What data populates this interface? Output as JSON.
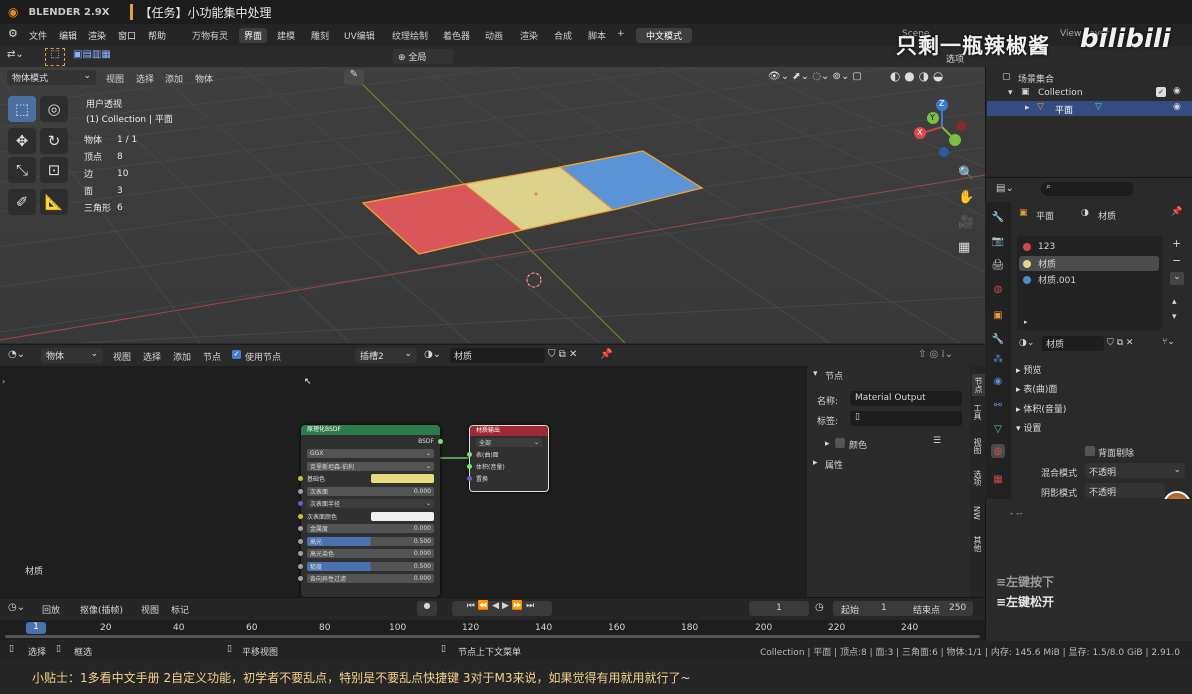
{
  "titlebar": {
    "app_name": "BLENDER 2.9X",
    "window_title": "【任务】小功能集中处理"
  },
  "overlay": {
    "channel_name": "只剩一瓶辣椒酱",
    "brand": "bilibili",
    "side_text": "Scene",
    "view_layer": "View Layer",
    "options": "选项"
  },
  "menu": {
    "items": [
      "文件",
      "编辑",
      "渲染",
      "窗口",
      "帮助"
    ]
  },
  "workspaces": {
    "tabs": [
      "万物有灵",
      "界面",
      "建模",
      "雕刻",
      "UV编辑",
      "纹理绘制",
      "着色器",
      "动画",
      "渲染",
      "合成",
      "脚本"
    ],
    "active": "界面",
    "add": "+",
    "mode_chip": "中文模式"
  },
  "viewport": {
    "mode": "物体模式",
    "menus": [
      "视图",
      "选择",
      "添加",
      "物体"
    ],
    "transform_orient": "全局",
    "view_name": "用户透视",
    "collection_info": "(1) Collection | 平面",
    "stats": [
      {
        "label": "物体",
        "value": "1 / 1"
      },
      {
        "label": "顶点",
        "value": "8"
      },
      {
        "label": "边",
        "value": "10"
      },
      {
        "label": "面",
        "value": "3"
      },
      {
        "label": "三角形",
        "value": "6"
      }
    ],
    "plane_colors": [
      "#d9565a",
      "#dcd28c",
      "#5a94d6"
    ],
    "gizmo": {
      "x": "X",
      "y": "Y",
      "z": "Z"
    }
  },
  "node_editor": {
    "type_icon": "node-editor-icon",
    "object_dropdown": "物体",
    "menus": [
      "视图",
      "选择",
      "添加",
      "节点"
    ],
    "use_nodes_label": "使用节点",
    "slot": "插槽2",
    "material_name": "材质",
    "area_label": "材质",
    "bsdf_node": {
      "title": "原理化BSDF",
      "output": "BSDF",
      "distribution": "GGX",
      "subsurface_method": "克里斯坦森-伯利",
      "rows": [
        {
          "label": "基础色",
          "value": "",
          "color": "#e8dc7c"
        },
        {
          "label": "次表面",
          "value": "0.000"
        },
        {
          "label": "次表面半径",
          "value": ""
        },
        {
          "label": "次表面颜色",
          "value": "",
          "color": "#efefef"
        },
        {
          "label": "金属度",
          "value": "0.000"
        },
        {
          "label": "高光",
          "value": "0.500",
          "fill": 0.5
        },
        {
          "label": "高光染色",
          "value": "0.000"
        },
        {
          "label": "糙度",
          "value": "0.500",
          "fill": 0.5
        },
        {
          "label": "各向异性过滤",
          "value": "0.000"
        }
      ]
    },
    "output_node": {
      "title": "材质输出",
      "target": "全部",
      "inputs": [
        "表(曲)面",
        "体积(音量)",
        "置换"
      ]
    },
    "sidebar": {
      "section": "节点",
      "name_label": "名称:",
      "name_value": "Material Output",
      "label_label": "标签:",
      "color_label": "颜色",
      "props_label": "属性"
    },
    "tabs": [
      "节点",
      "工具",
      "视图",
      "选项",
      "NW",
      "其他"
    ]
  },
  "timeline": {
    "menus": [
      "回放",
      "抠像(插帧)",
      "视图",
      "标记"
    ],
    "current_frame": "1",
    "start_label": "起始",
    "start": "1",
    "end_label": "结束点",
    "end": "250",
    "ruler": [
      "1",
      "20",
      "40",
      "60",
      "80",
      "100",
      "120",
      "140",
      "160",
      "180",
      "200",
      "220",
      "240"
    ]
  },
  "statusbar": {
    "left": [
      {
        "icon": "mouse-left-icon",
        "text": "选择"
      },
      {
        "icon": "mouse-right-icon",
        "text": "框选"
      },
      {
        "icon": "mouse-middle-icon",
        "text": "平移视图"
      },
      {
        "icon": "mouse-icon",
        "text": "节点上下文菜单"
      }
    ],
    "right": "Collection | 平面 | 顶点:8 | 面:3 | 三角面:6 | 物体:1/1 | 内存: 145.6 MiB | 显存: 1.5/8.0 GiB | 2.91.0"
  },
  "subtitle": "小贴士：1多看中文手册 2自定义功能，初学者不要乱点，特别是不要乱点快捷键 3对于M3来说，如果觉得有用就用就行了~",
  "outliner": {
    "root": "场景集合",
    "collection": "Collection",
    "object": "平面"
  },
  "properties": {
    "object": "平面",
    "material_tab": "材质",
    "slots": [
      {
        "name": "123",
        "color": "#d04848"
      },
      {
        "name": "材质",
        "color": "#e0d88c",
        "selected": true
      },
      {
        "name": "材质.001",
        "color": "#4a8ed0"
      }
    ],
    "material_field": "材质",
    "sections": [
      "预览",
      "表(曲)面",
      "体积(音量)",
      "设置"
    ],
    "backface_label": "背面剔除",
    "blend_label": "混合模式",
    "blend_value": "不透明",
    "shadow_label": "阴影模式",
    "shadow_value": "不透明"
  },
  "key_display": {
    "dashes": "-   --",
    "line1": "≡左键按下",
    "line2": "≡左键松开"
  }
}
